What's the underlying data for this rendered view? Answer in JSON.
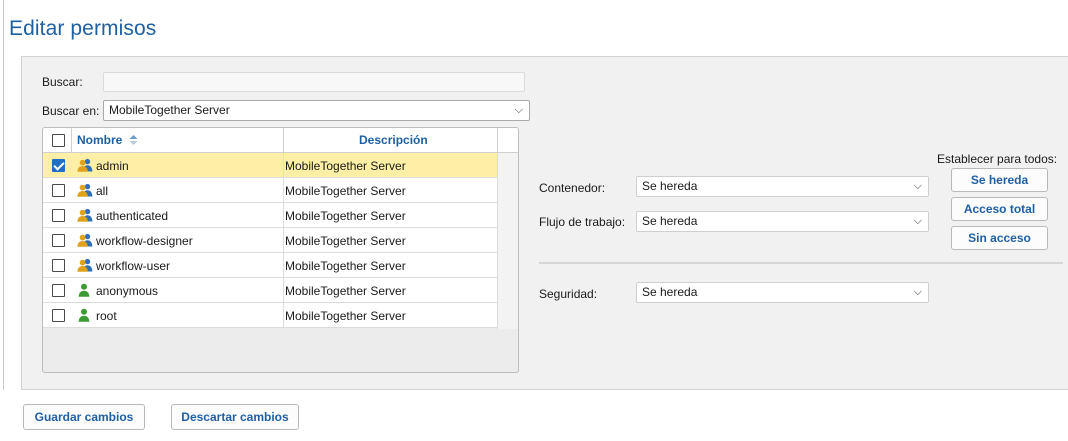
{
  "page_title": "Editar permisos",
  "search": {
    "label": "Buscar:",
    "value": "",
    "placeholder": ""
  },
  "search_in": {
    "label": "Buscar en:",
    "selected": "MobileTogether Server"
  },
  "table": {
    "columns": {
      "name": "Nombre",
      "description": "Descripción"
    },
    "sort_icon": "sort-ascending-icon",
    "rows": [
      {
        "name": "admin",
        "description": "MobileTogether Server",
        "checked": true,
        "selected": true,
        "icon": "user-group-icon"
      },
      {
        "name": "all",
        "description": "MobileTogether Server",
        "checked": false,
        "selected": false,
        "icon": "user-group-icon"
      },
      {
        "name": "authenticated",
        "description": "MobileTogether Server",
        "checked": false,
        "selected": false,
        "icon": "user-group-icon"
      },
      {
        "name": "workflow-designer",
        "description": "MobileTogether Server",
        "checked": false,
        "selected": false,
        "icon": "user-group-icon"
      },
      {
        "name": "workflow-user",
        "description": "MobileTogether Server",
        "checked": false,
        "selected": false,
        "icon": "user-group-icon"
      },
      {
        "name": "anonymous",
        "description": "MobileTogether Server",
        "checked": false,
        "selected": false,
        "icon": "user-icon"
      },
      {
        "name": "root",
        "description": "MobileTogether Server",
        "checked": false,
        "selected": false,
        "icon": "user-icon"
      }
    ]
  },
  "permissions": {
    "container": {
      "label": "Contenedor:",
      "value": "Se hereda"
    },
    "workflow": {
      "label": "Flujo de trabajo:",
      "value": "Se hereda"
    },
    "security": {
      "label": "Seguridad:",
      "value": "Se hereda"
    }
  },
  "set_all": {
    "label": "Establecer para todos:",
    "inherit": "Se hereda",
    "full_access": "Acceso total",
    "no_access": "Sin acceso"
  },
  "footer": {
    "save": "Guardar cambios",
    "discard": "Descartar cambios"
  },
  "colors": {
    "accent": "#1f5fa3",
    "selected_row": "#fdf0a6",
    "group_icon_orange": "#e0a21b",
    "group_icon_blue": "#2f6fb8",
    "user_icon_green": "#3c9a32"
  }
}
